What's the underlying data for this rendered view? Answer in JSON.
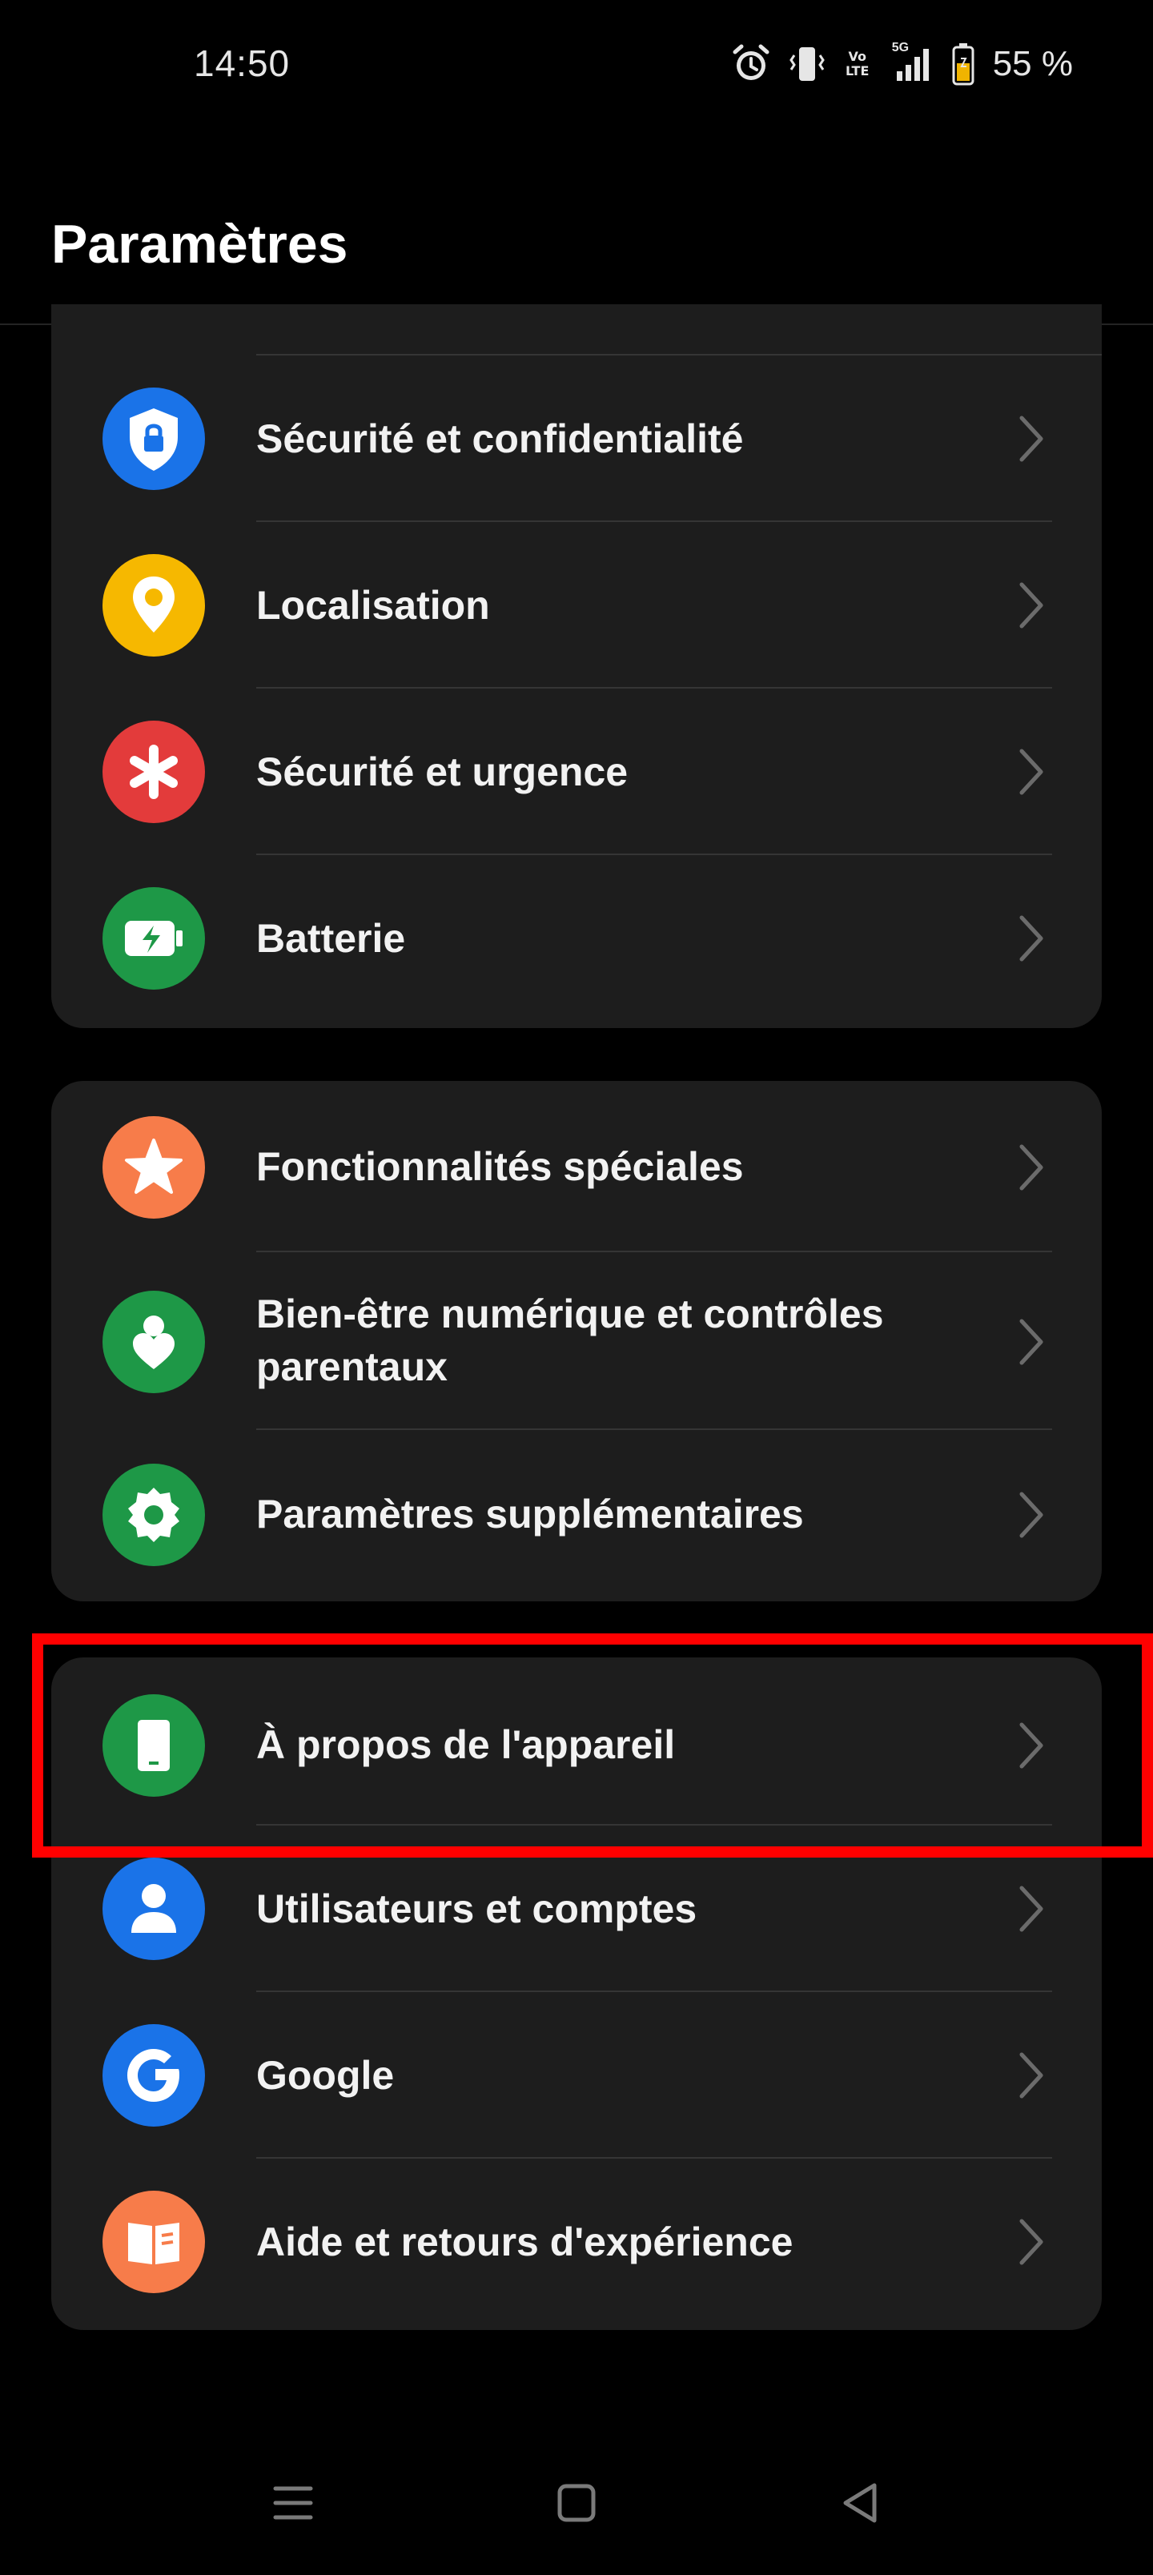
{
  "status_bar": {
    "time": "14:50",
    "network_label": "5G",
    "volte_label_top": "Vo",
    "volte_label_bottom": "LTE",
    "battery_text": "55 %",
    "icons": [
      "alarm-icon",
      "vibrate-icon",
      "volte-icon",
      "signal-icon",
      "battery-icon"
    ]
  },
  "header": {
    "title": "Paramètres"
  },
  "groups": [
    {
      "items": [
        {
          "label": "Sécurité et confidentialité",
          "icon": "shield-lock-icon",
          "color": "#1a73e8"
        },
        {
          "label": "Localisation",
          "icon": "location-pin-icon",
          "color": "#f6b800"
        },
        {
          "label": "Sécurité et urgence",
          "icon": "asterisk-icon",
          "color": "#e33b3b"
        },
        {
          "label": "Batterie",
          "icon": "battery-charging-icon",
          "color": "#1e9847"
        }
      ]
    },
    {
      "items": [
        {
          "label": "Fonctionnalités spéciales",
          "icon": "star-icon",
          "color": "#f77c4a"
        },
        {
          "label": "Bien-être numérique et contrôles parentaux",
          "icon": "wellbeing-icon",
          "color": "#1e9847"
        },
        {
          "label": "Paramètres supplémentaires",
          "icon": "gear-icon",
          "color": "#1e9847"
        }
      ]
    },
    {
      "items": [
        {
          "label": "À propos de l'appareil",
          "icon": "phone-device-icon",
          "color": "#1e9847"
        },
        {
          "label": "Utilisateurs et comptes",
          "icon": "user-icon",
          "color": "#1a73e8"
        },
        {
          "label": "Google",
          "icon": "google-icon",
          "color": "#1a73e8"
        },
        {
          "label": "Aide et retours d'expérience",
          "icon": "help-book-icon",
          "color": "#f77c4a"
        }
      ]
    }
  ],
  "nav_bar": {
    "buttons": [
      "menu-icon",
      "home-icon",
      "back-icon"
    ]
  },
  "colors": {
    "background": "#000000",
    "card": "#1d1d1d",
    "divider": "#353535",
    "highlight": "#ff0000",
    "text": "#f2f2f2",
    "chevron": "#6b6b6b"
  }
}
